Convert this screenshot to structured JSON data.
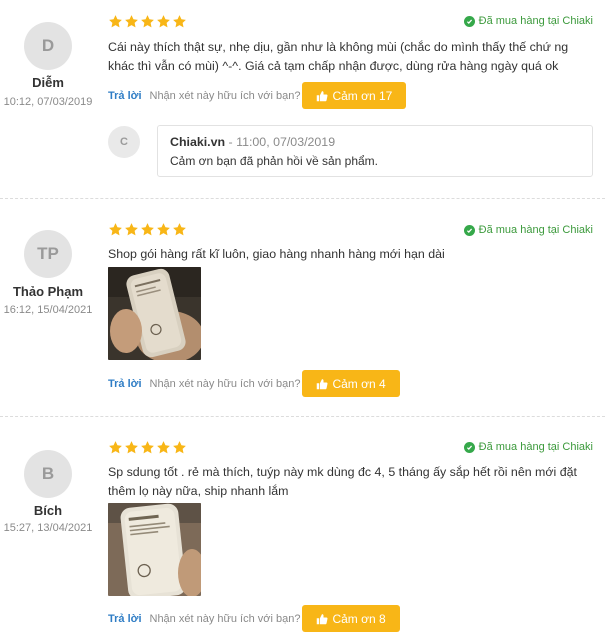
{
  "labels": {
    "verified": "Đã mua hàng tại Chiaki",
    "reply": "Trả lời",
    "helpful_question": "Nhận xét này hữu ích với bạn?"
  },
  "colors": {
    "star": "#f8b617",
    "button": "#f8b617",
    "verified": "#3c9a3c",
    "link": "#2f7dc5"
  },
  "reviews": [
    {
      "initial": "D",
      "name": "Diễm",
      "date": "10:12, 07/03/2019",
      "rating": 5,
      "text": "Cái này thích thật sự, nhẹ dịu, gần như là không mùi (chắc do mình thấy thế chứ ng khác thì vẫn có mùi) ^-^. Giá cả tạm chấp nhận được, dùng rửa hàng ngày quá ok",
      "thanks": "Cảm ơn 17",
      "shop_reply": {
        "initial": "C",
        "name": "Chiaki.vn",
        "time": " - 11:00, 07/03/2019",
        "text": "Cảm ơn bạn đã phản hồi về sản phẩm."
      }
    },
    {
      "initial": "TP",
      "name": "Thảo Phạm",
      "date": "16:12, 15/04/2021",
      "rating": 5,
      "text": "Shop gói hàng rất kĩ luôn, giao hàng nhanh hàng mới hạn dài",
      "photo": "innisfree",
      "thanks": "Cảm ơn 4"
    },
    {
      "initial": "B",
      "name": "Bích",
      "date": "15:27, 13/04/2021",
      "rating": 5,
      "text": "Sp sdung tốt . rẻ mà thích, tuýp này mk dùng đc 4, 5 tháng ấy sắp hết rồi nên mới đặt thêm lọ này nữa, ship nhanh lắm",
      "photo": "innisfree",
      "thanks": "Cảm ơn 8"
    }
  ]
}
